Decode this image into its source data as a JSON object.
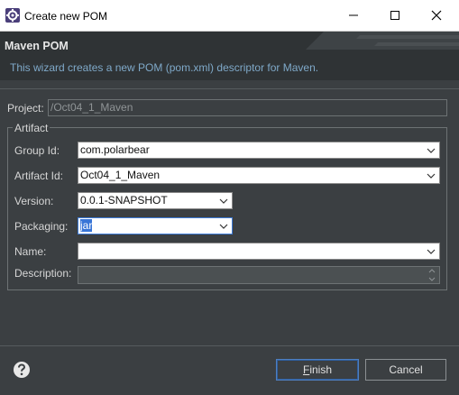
{
  "window": {
    "title": "Create new POM"
  },
  "banner": {
    "title": "Maven POM",
    "description": "This wizard creates a new POM (pom.xml) descriptor for Maven."
  },
  "project": {
    "label": "Project:",
    "value": "/Oct04_1_Maven"
  },
  "artifact": {
    "group_title": "Artifact",
    "group_id": {
      "label": "Group Id:",
      "value": "com.polarbear"
    },
    "artifact_id": {
      "label": "Artifact Id:",
      "value": "Oct04_1_Maven"
    },
    "version": {
      "label": "Version:",
      "value": "0.0.1-SNAPSHOT"
    },
    "packaging": {
      "label": "Packaging:",
      "value": "jar"
    },
    "name": {
      "label": "Name:",
      "value": ""
    },
    "description": {
      "label": "Description:",
      "value": ""
    }
  },
  "footer": {
    "finish_mnemonic": "F",
    "finish_rest": "inish",
    "cancel_label": "Cancel"
  },
  "icons": {
    "app": "eclipse-gear-icon",
    "help": "help-icon"
  },
  "colors": {
    "background": "#3b3f42",
    "banner": "#2f3335",
    "accent": "#3875d7",
    "description_text": "#7fa9c9"
  }
}
